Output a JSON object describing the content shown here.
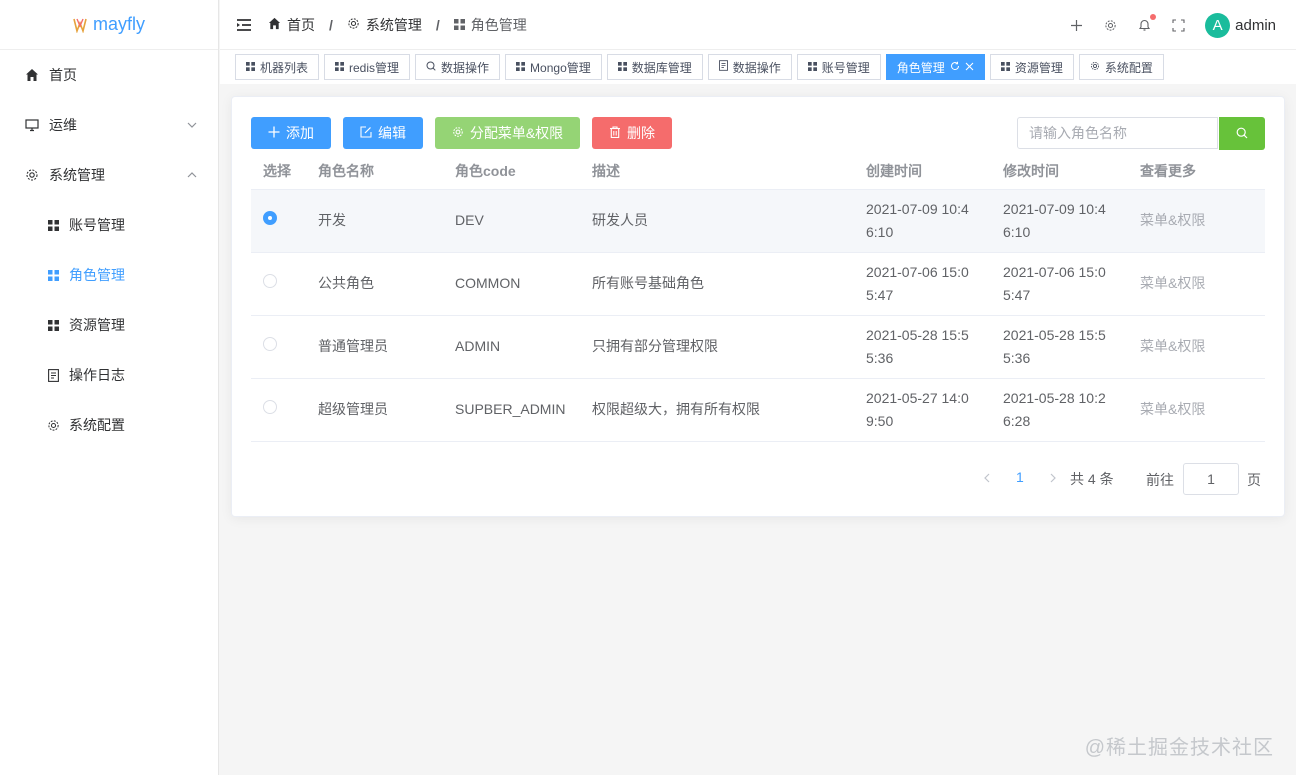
{
  "app": {
    "name": "mayfly"
  },
  "sidebar": {
    "items": [
      {
        "label": "首页",
        "icon": "home-icon"
      },
      {
        "label": "运维",
        "icon": "monitor-icon"
      },
      {
        "label": "系统管理",
        "icon": "gear-icon"
      }
    ],
    "subitems": [
      {
        "label": "账号管理",
        "icon": "grid-icon"
      },
      {
        "label": "角色管理",
        "icon": "grid-icon",
        "active": true
      },
      {
        "label": "资源管理",
        "icon": "grid-icon"
      },
      {
        "label": "操作日志",
        "icon": "document-icon"
      },
      {
        "label": "系统配置",
        "icon": "gear-icon"
      }
    ]
  },
  "header": {
    "breadcrumb": [
      "首页",
      "系统管理",
      "角色管理"
    ],
    "separator": "/",
    "user": {
      "avatar_letter": "A",
      "name": "admin"
    }
  },
  "tags": [
    "机器列表",
    "redis管理",
    "数据操作",
    "Mongo管理",
    "数据库管理",
    "数据操作",
    "账号管理",
    "角色管理",
    "资源管理",
    "系统配置"
  ],
  "toolbar": {
    "add": "添加",
    "edit": "编辑",
    "assign": "分配菜单&权限",
    "delete": "删除",
    "search_placeholder": "请输入角色名称"
  },
  "table": {
    "columns": [
      "选择",
      "角色名称",
      "角色code",
      "描述",
      "创建时间",
      "修改时间",
      "查看更多"
    ],
    "rows": [
      {
        "name": "开发",
        "code": "DEV",
        "desc": "研发人员",
        "created": "2021-07-09 10:46:10",
        "modified": "2021-07-09 10:46:10",
        "more": "菜单&权限",
        "selected": true
      },
      {
        "name": "公共角色",
        "code": "COMMON",
        "desc": "所有账号基础角色",
        "created": "2021-07-06 15:05:47",
        "modified": "2021-07-06 15:05:47",
        "more": "菜单&权限",
        "selected": false
      },
      {
        "name": "普通管理员",
        "code": "ADMIN",
        "desc": "只拥有部分管理权限",
        "created": "2021-05-28 15:55:36",
        "modified": "2021-05-28 15:55:36",
        "more": "菜单&权限",
        "selected": false
      },
      {
        "name": "超级管理员",
        "code": "SUPBER_ADMIN",
        "desc": "权限超级大，拥有所有权限",
        "created": "2021-05-27 14:09:50",
        "modified": "2021-05-28 10:26:28",
        "more": "菜单&权限",
        "selected": false
      }
    ]
  },
  "pagination": {
    "current": "1",
    "total": "共 4 条",
    "goto_label": "前往",
    "goto_value": "1",
    "page_label": "页"
  },
  "watermark": "@稀土掘金技术社区",
  "colors": {
    "primary": "#409eff",
    "success": "#67c23a",
    "danger": "#f56c6c",
    "assign": "#95d475"
  }
}
